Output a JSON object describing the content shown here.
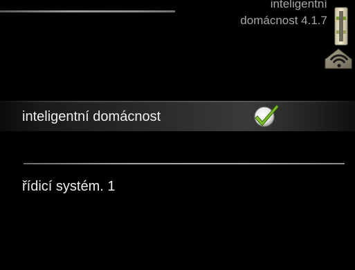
{
  "header": {
    "title_line1": "inteligentní",
    "title_line2": "domácnost 4.1.7"
  },
  "icons": {
    "thermometer": "thermometer-icon",
    "wifi_house": "wifi-house-icon",
    "checkmark": "checkmark-icon"
  },
  "menu": {
    "items": [
      {
        "label": "inteligentní domácnost",
        "checked": true
      },
      {
        "label": "řídicí systém. 1"
      }
    ]
  },
  "colors": {
    "background": "#000000",
    "text": "#eeeeee",
    "title_text": "#a9a9a9",
    "check_green": "#6fbf1a"
  }
}
